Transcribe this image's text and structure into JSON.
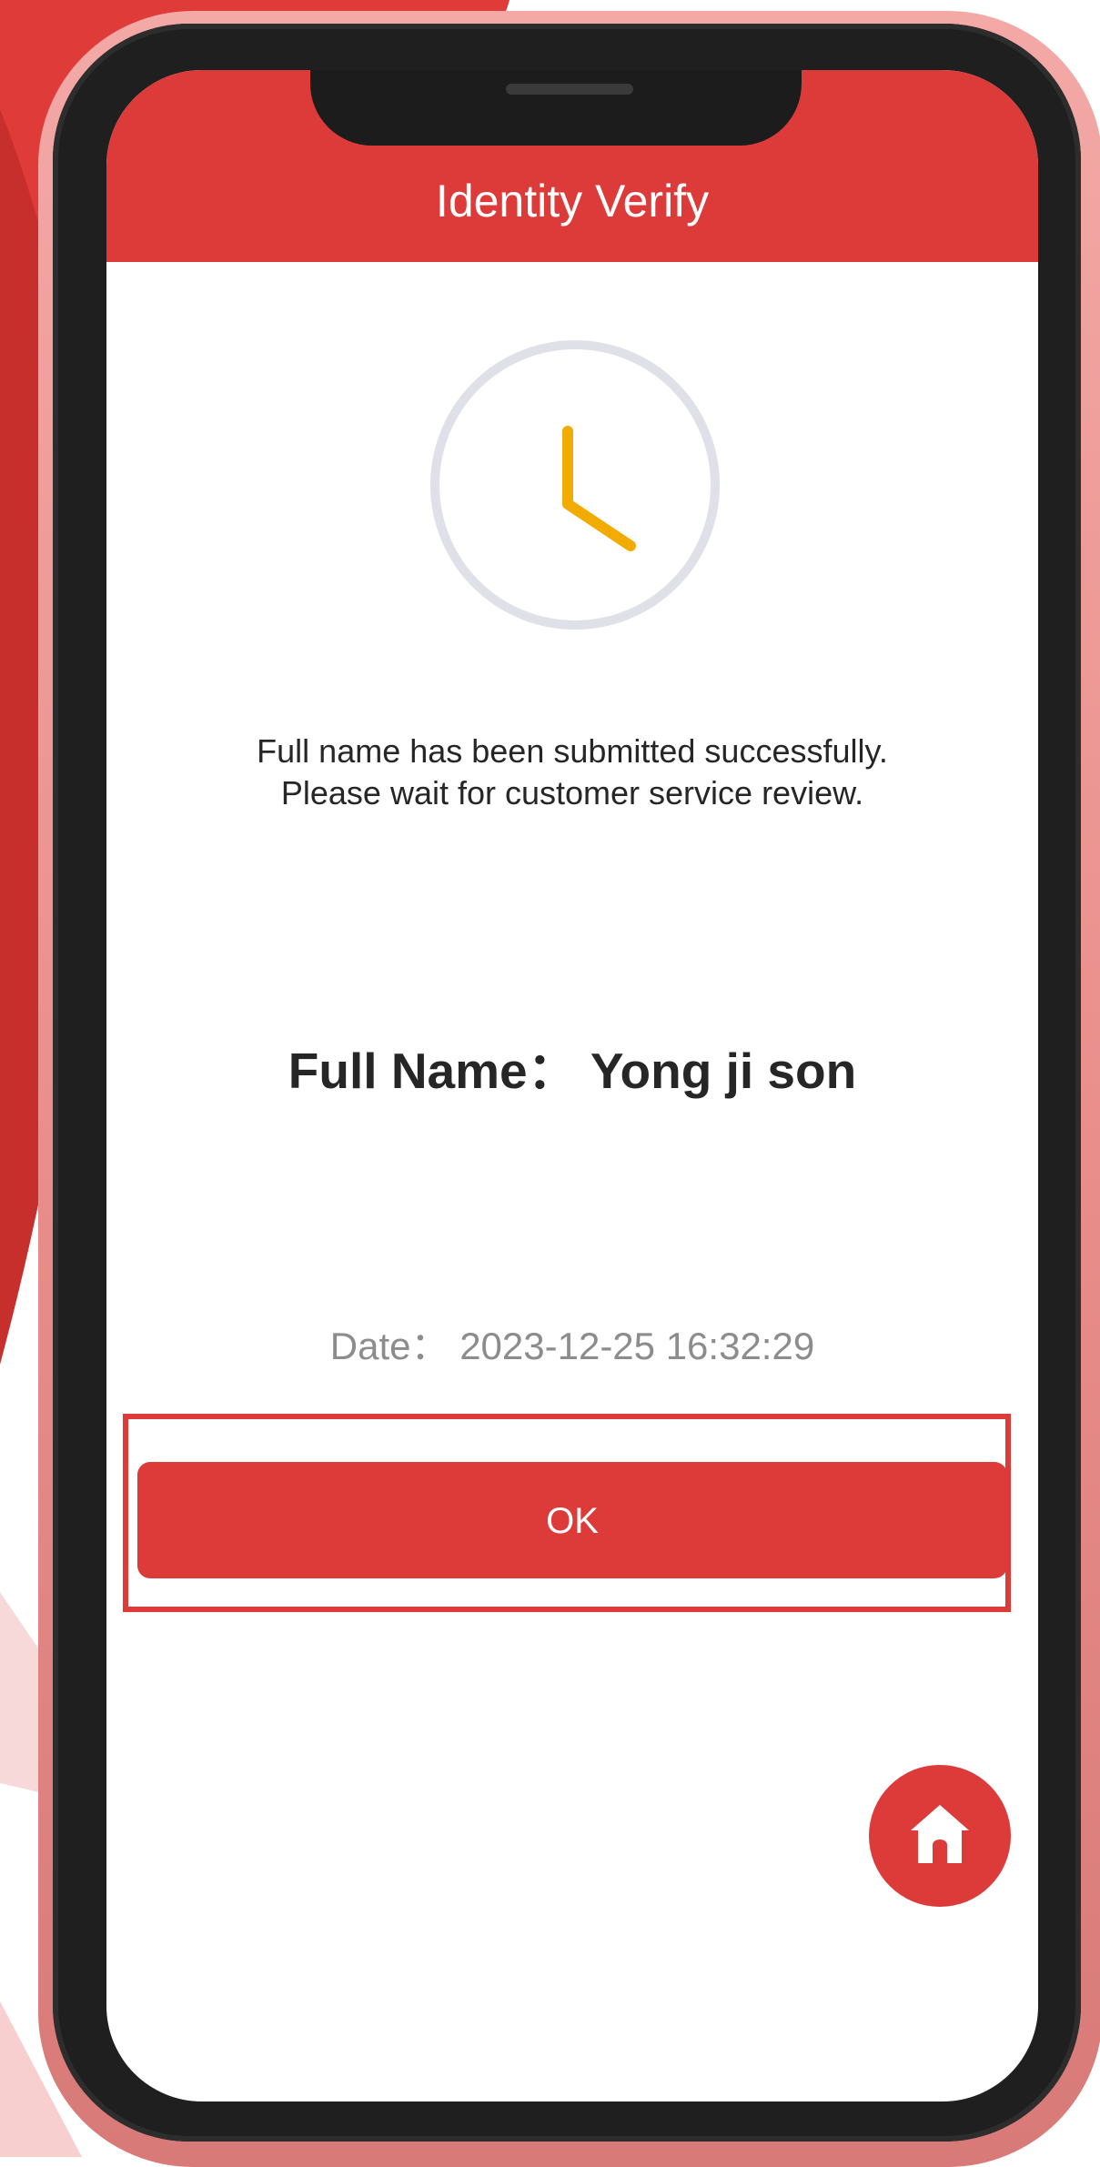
{
  "header": {
    "title": "Identity Verify"
  },
  "status": {
    "icon": "clock-icon",
    "message_line1": "Full name has been submitted successfully.",
    "message_line2": "Please wait for customer service review."
  },
  "identity": {
    "full_name_label": "Full Name：",
    "full_name_value": "Yong ji son",
    "date_label": "Date：",
    "date_value": "2023-12-25 16:32:29"
  },
  "actions": {
    "ok_label": "OK",
    "home_icon": "home-icon"
  },
  "colors": {
    "accent": "#dd3b39",
    "clock_hand": "#f2ab00",
    "clock_ring": "#dfe0e8",
    "text_primary": "#262626",
    "text_secondary": "#8c8c8c"
  }
}
